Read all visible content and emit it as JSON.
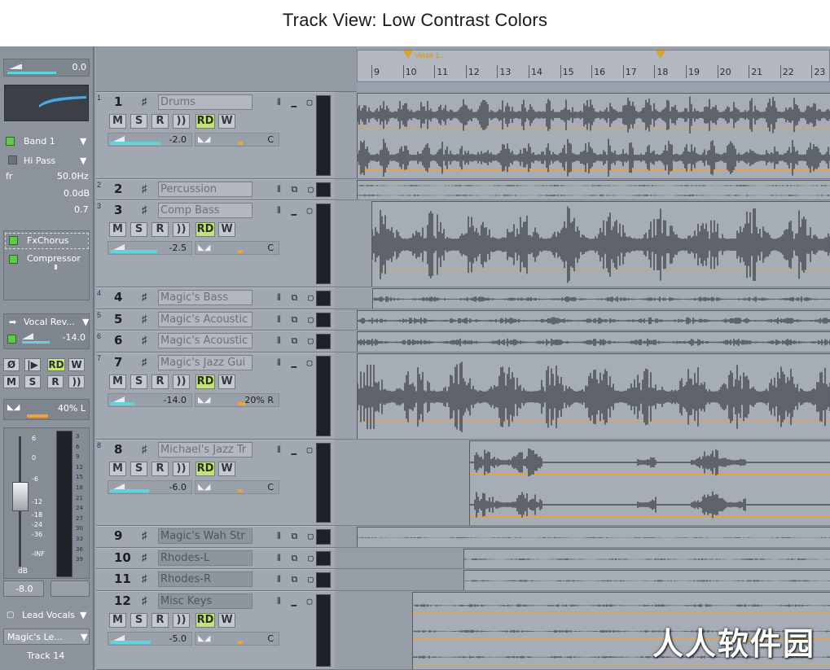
{
  "caption": "Track View:  Low Contrast Colors",
  "colors": {
    "accent_volume": "#5fd3e0",
    "accent_pan": "#f0a23a",
    "rd_button": "#c6e07a",
    "fx_enabled": "#62c94a"
  },
  "inspector": {
    "top_value": "0.0",
    "eq_band": "Band 1",
    "filter_type": "Hi Pass",
    "freq_label": "fr",
    "freq_value": "50.0Hz",
    "gain_value": "0.0dB",
    "q_value": "0.7",
    "fx_chain": [
      "FxChorus",
      "Compressor"
    ],
    "send_name": "Vocal Rev...",
    "send_value": "-14.0",
    "buttons_row1": [
      "Ø",
      "|▶",
      "RD",
      "W"
    ],
    "buttons_row2": [
      "M",
      "S",
      "R",
      "))"
    ],
    "pan_value": "40% L",
    "fader_scale": [
      "6",
      "0",
      "-6",
      "-12",
      "-18",
      "-24",
      "-36",
      "-INF"
    ],
    "meter_scale": [
      "3",
      "6",
      "9",
      "12",
      "15",
      "18",
      "21",
      "24",
      "27",
      "30",
      "33",
      "36",
      "39"
    ],
    "fader_unit": "dB",
    "fader_value": "-8.0",
    "output": "Lead Vocals",
    "input": "Magic's Le...",
    "track_label": "Track 14"
  },
  "ruler": {
    "marker_left": "Verse 1...",
    "ticks": [
      "9",
      "10",
      "11",
      "12",
      "13",
      "14",
      "15",
      "16",
      "17",
      "18",
      "19",
      "20",
      "21",
      "22",
      "23"
    ]
  },
  "track_buttons": [
    "M",
    "S",
    "R",
    "))",
    "RD",
    "W"
  ],
  "tracks": [
    {
      "index": "1",
      "number": "1",
      "name": "Drums",
      "volume": "-2.0",
      "pan": "C",
      "vol_fill": 0.62,
      "pan_pos": 0.5
    },
    {
      "index": "2",
      "number": "2",
      "name": "Percussion"
    },
    {
      "index": "3",
      "number": "3",
      "name": "Comp Bass",
      "volume": "-2.5",
      "pan": "C",
      "vol_fill": 0.58,
      "pan_pos": 0.5
    },
    {
      "index": "4",
      "number": "4",
      "name": "Magic's Bass"
    },
    {
      "index": "5",
      "number": "5",
      "name": "Magic's Acoustic"
    },
    {
      "index": "6",
      "number": "6",
      "name": "Magic's Acoustic"
    },
    {
      "index": "7",
      "number": "7",
      "name": "Magic's Jazz Gui",
      "volume": "-14.0",
      "pan": "20% R",
      "vol_fill": 0.3,
      "pan_pos": 0.6
    },
    {
      "index": "8",
      "number": "8",
      "name": "Michael's Jazz Tr",
      "volume": "-6.0",
      "pan": "C",
      "vol_fill": 0.48,
      "pan_pos": 0.5
    },
    {
      "index": "",
      "number": "9",
      "name": "Magic's Wah Str"
    },
    {
      "index": "",
      "number": "10",
      "name": "Rhodes-L"
    },
    {
      "index": "",
      "number": "11",
      "name": "Rhodes-R"
    },
    {
      "index": "",
      "number": "12",
      "name": "Misc Keys",
      "volume": "-5.0",
      "pan": "C",
      "vol_fill": 0.5,
      "pan_pos": 0.5
    }
  ],
  "watermark": "人人软件园"
}
